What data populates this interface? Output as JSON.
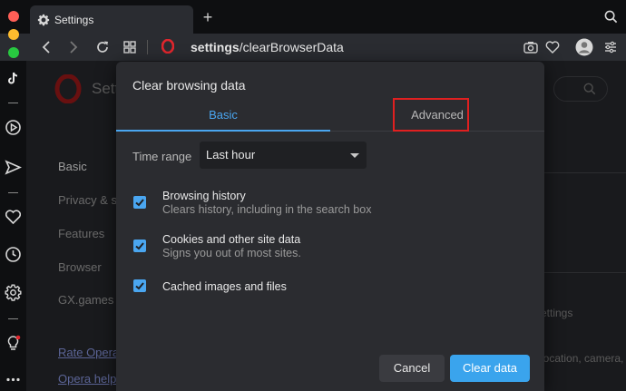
{
  "browser": {
    "tab_title": "Settings",
    "new_tab_symbol": "+",
    "address": {
      "bold": "settings",
      "rest": "/clearBrowserData"
    }
  },
  "page": {
    "title": "Sett",
    "nav_items": [
      {
        "label": "Basic"
      },
      {
        "label": "Privacy & s"
      },
      {
        "label": "Features"
      },
      {
        "label": "Browser"
      },
      {
        "label": "GX.games"
      }
    ],
    "links": [
      {
        "label": "Rate Opera"
      },
      {
        "label": "Opera help"
      }
    ],
    "right_text": [
      {
        "text": "ettings"
      },
      {
        "text": "location, camera,"
      }
    ]
  },
  "dialog": {
    "title": "Clear browsing data",
    "tabs": [
      {
        "label": "Basic",
        "selected": true
      },
      {
        "label": "Advanced",
        "selected": false
      }
    ],
    "time_range": {
      "label": "Time range",
      "value": "Last hour"
    },
    "options": [
      {
        "title": "Browsing history",
        "description": "Clears history, including in the search box",
        "checked": true
      },
      {
        "title": "Cookies and other site data",
        "description": "Signs you out of most sites.",
        "checked": true
      },
      {
        "title": "Cached images and files",
        "description": "",
        "checked": true
      }
    ],
    "buttons": {
      "cancel": "Cancel",
      "clear": "Clear data"
    }
  },
  "colors": {
    "accent": "#4aa6f0",
    "highlight": "#e02020",
    "opera_red": "#cc1b1b"
  }
}
